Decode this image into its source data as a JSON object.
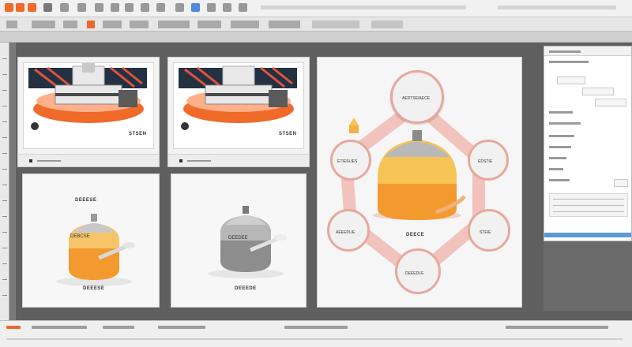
{
  "toolbar": {
    "icons": [
      "app-logo-icon",
      "new-icon",
      "open-icon",
      "save-icon",
      "undo-icon",
      "redo-icon",
      "settings-icon"
    ]
  },
  "slides": {
    "panel1_caption": "STSEN",
    "panel2_caption": "STSEN",
    "panel3_caption": "DEEESE",
    "panel4_caption": "DEEEDE",
    "panel3_label": "DEBCSE",
    "panel4_label": "DEEDEE"
  },
  "diagram": {
    "center_label": "DEECE",
    "node_top": "AEDTSEIAECE",
    "node_left": "ETIESLIES",
    "node_right": "EDSTIE",
    "node_bottom_left": "AEEEDLIE",
    "node_bottom_right": "STEIE",
    "node_bottom": "DEEEDLE"
  },
  "colors": {
    "accent_orange": "#f06a2a",
    "accent_red": "#d9442c",
    "vessel_orange": "#f39a2e",
    "vessel_gray": "#8d8d8d",
    "link_pink": "#f0b7ae"
  }
}
